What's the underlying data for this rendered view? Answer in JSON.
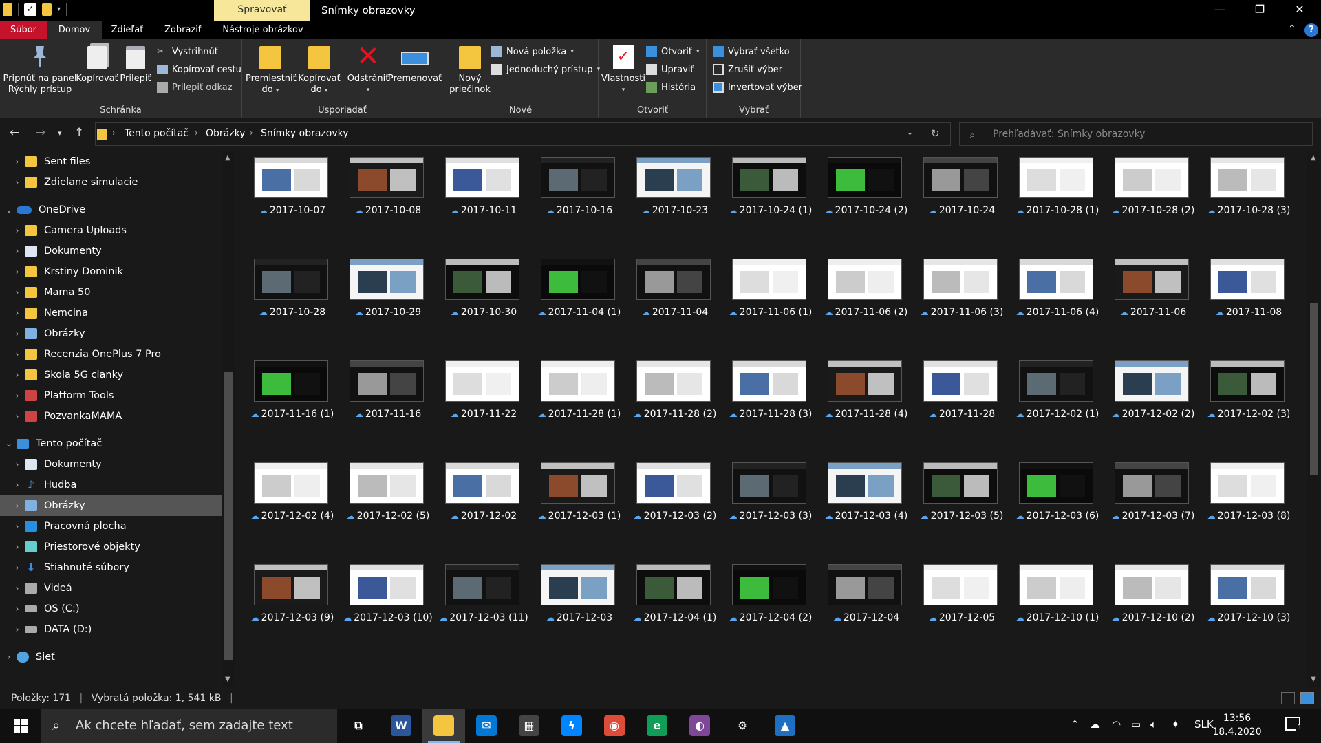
{
  "window": {
    "context_tab": "Spravovať",
    "title": "Snímky obrazovky",
    "minimize": "—",
    "restore": "❐",
    "close": "✕"
  },
  "ribbon_tabs": {
    "file": "Súbor",
    "home": "Domov",
    "share": "Zdieľať",
    "view": "Zobraziť",
    "picture_tools": "Nástroje obrázkov",
    "collapse": "⌃",
    "help": "?"
  },
  "ribbon": {
    "clipboard": {
      "label": "Schránka",
      "pin_line1": "Pripnúť na panel",
      "pin_line2": "Rýchly prístup",
      "copy": "Kopírovať",
      "paste": "Prilepiť",
      "cut": "Vystrihnúť",
      "copy_path": "Kopírovať cestu",
      "paste_shortcut": "Prilepiť odkaz"
    },
    "organize": {
      "label": "Usporiadať",
      "move_line1": "Premiestniť",
      "move_line2": "do",
      "copy_line1": "Kopírovať",
      "copy_line2": "do",
      "delete": "Odstrániť",
      "rename": "Premenovať"
    },
    "new": {
      "label": "Nové",
      "folder_line1": "Nový",
      "folder_line2": "priečinok",
      "new_item": "Nová položka",
      "easy_access": "Jednoduchý prístup"
    },
    "open": {
      "label": "Otvoriť",
      "properties": "Vlastnosti",
      "open": "Otvoriť",
      "edit": "Upraviť",
      "history": "História"
    },
    "select": {
      "label": "Vybrať",
      "select_all": "Vybrať všetko",
      "select_none": "Zrušiť výber",
      "invert": "Invertovať výber"
    }
  },
  "address": {
    "crumbs": [
      "Tento počítač",
      "Obrázky",
      "Snímky obrazovky"
    ],
    "search_placeholder": "Prehľadávať: Snímky obrazovky"
  },
  "nav_tree": [
    {
      "label": "Sent files",
      "icon": "folder",
      "indent": 1,
      "chevron": "›"
    },
    {
      "label": "Zdielane simulacie",
      "icon": "folder",
      "indent": 1,
      "chevron": "›"
    },
    {
      "label": "OneDrive",
      "icon": "cloud",
      "indent": 0,
      "chevron": "⌄"
    },
    {
      "label": "Camera Uploads",
      "icon": "folder",
      "indent": 1,
      "chevron": "›"
    },
    {
      "label": "Dokumenty",
      "icon": "doc",
      "indent": 1,
      "chevron": "›"
    },
    {
      "label": "Krstiny Dominik",
      "icon": "folder",
      "indent": 1,
      "chevron": "›"
    },
    {
      "label": "Mama 50",
      "icon": "folder",
      "indent": 1,
      "chevron": "›"
    },
    {
      "label": "Nemcina",
      "icon": "folder",
      "indent": 1,
      "chevron": "›"
    },
    {
      "label": "Obrázky",
      "icon": "pic",
      "indent": 1,
      "chevron": "›"
    },
    {
      "label": "Recenzia OnePlus 7 Pro",
      "icon": "folder",
      "indent": 1,
      "chevron": "›"
    },
    {
      "label": "Skola 5G clanky",
      "icon": "folder",
      "indent": 1,
      "chevron": "›"
    },
    {
      "label": "Platform Tools",
      "icon": "zip",
      "indent": 1,
      "chevron": "›"
    },
    {
      "label": "PozvankaMAMA",
      "icon": "zip",
      "indent": 1,
      "chevron": "›"
    },
    {
      "label": "Tento počítač",
      "icon": "pc",
      "indent": 0,
      "chevron": "⌄"
    },
    {
      "label": "Dokumenty",
      "icon": "doc",
      "indent": 1,
      "chevron": "›"
    },
    {
      "label": "Hudba",
      "icon": "music",
      "indent": 1,
      "chevron": "›"
    },
    {
      "label": "Obrázky",
      "icon": "pic",
      "indent": 1,
      "chevron": "›",
      "selected": true
    },
    {
      "label": "Pracovná plocha",
      "icon": "desk",
      "indent": 1,
      "chevron": "›"
    },
    {
      "label": "Priestorové objekty",
      "icon": "3d",
      "indent": 1,
      "chevron": "›"
    },
    {
      "label": "Stiahnuté súbory",
      "icon": "down",
      "indent": 1,
      "chevron": "›"
    },
    {
      "label": "Videá",
      "icon": "video",
      "indent": 1,
      "chevron": "›"
    },
    {
      "label": "OS (C:)",
      "icon": "drive",
      "indent": 1,
      "chevron": "›"
    },
    {
      "label": "DATA (D:)",
      "icon": "drive",
      "indent": 1,
      "chevron": "›"
    },
    {
      "label": "Sieť",
      "icon": "net",
      "indent": 0,
      "chevron": "›"
    }
  ],
  "files": [
    [
      "2017-10-07",
      "2017-10-08",
      "2017-10-11",
      "2017-10-16",
      "2017-10-23",
      "2017-10-24 (1)",
      "2017-10-24 (2)",
      "2017-10-24",
      "2017-10-28 (1)",
      "2017-10-28 (2)",
      "2017-10-28 (3)"
    ],
    [
      "2017-10-28",
      "2017-10-29",
      "2017-10-30",
      "2017-11-04 (1)",
      "2017-11-04",
      "2017-11-06 (1)",
      "2017-11-06 (2)",
      "2017-11-06 (3)",
      "2017-11-06 (4)",
      "2017-11-06",
      "2017-11-08"
    ],
    [
      "2017-11-16 (1)",
      "2017-11-16",
      "2017-11-22",
      "2017-11-28 (1)",
      "2017-11-28 (2)",
      "2017-11-28 (3)",
      "2017-11-28 (4)",
      "2017-11-28",
      "2017-12-02 (1)",
      "2017-12-02 (2)",
      "2017-12-02 (3)"
    ],
    [
      "2017-12-02 (4)",
      "2017-12-02 (5)",
      "2017-12-02",
      "2017-12-03 (1)",
      "2017-12-03 (2)",
      "2017-12-03 (3)",
      "2017-12-03 (4)",
      "2017-12-03 (5)",
      "2017-12-03 (6)",
      "2017-12-03 (7)",
      "2017-12-03 (8)"
    ],
    [
      "2017-12-03 (9)",
      "2017-12-03 (10)",
      "2017-12-03 (11)",
      "2017-12-03",
      "2017-12-04 (1)",
      "2017-12-04 (2)",
      "2017-12-04",
      "2017-12-05",
      "2017-12-10 (1)",
      "2017-12-10 (2)",
      "2017-12-10 (3)"
    ]
  ],
  "thumb_palette": [
    [
      "#ffffff",
      "#4a6fa5",
      "#d9d9d9"
    ],
    [
      "#1a1a1a",
      "#8b4a2b",
      "#c0c0c0"
    ],
    [
      "#ffffff",
      "#3b5998",
      "#e0e0e0"
    ],
    [
      "#111111",
      "#5c6b73",
      "#222222"
    ],
    [
      "#f5f5f5",
      "#2b3e50",
      "#7aa0c4"
    ],
    [
      "#0d0d0d",
      "#3a5a3a",
      "#bbbbbb"
    ],
    [
      "#0a0a0a",
      "#3dbb3d",
      "#111111"
    ],
    [
      "#111111",
      "#999999",
      "#444444"
    ],
    [
      "#ffffff",
      "#dddddd",
      "#f0f0f0"
    ],
    [
      "#ffffff",
      "#cccccc",
      "#eeeeee"
    ],
    [
      "#ffffff",
      "#bbbbbb",
      "#e6e6e6"
    ]
  ],
  "status": {
    "count": "Položky: 171",
    "selected": "Vybratá položka: 1, 541 kB"
  },
  "taskbar": {
    "search_placeholder": "Ak chcete hľadať, sem zadajte text",
    "apps": [
      {
        "name": "task-view",
        "glyph": "⧉",
        "color": "transparent"
      },
      {
        "name": "word",
        "glyph": "W",
        "color": "#2b579a"
      },
      {
        "name": "file-explorer",
        "glyph": "",
        "color": "#f4c53f",
        "active": true
      },
      {
        "name": "mail",
        "glyph": "✉",
        "color": "#0078d4"
      },
      {
        "name": "store",
        "glyph": "▦",
        "color": "#444444"
      },
      {
        "name": "messenger",
        "glyph": "ϟ",
        "color": "#0084ff"
      },
      {
        "name": "chrome",
        "glyph": "◉",
        "color": "#dd4b39"
      },
      {
        "name": "edge-beta",
        "glyph": "e",
        "color": "#0f9d58"
      },
      {
        "name": "tor",
        "glyph": "◐",
        "color": "#7e4798"
      },
      {
        "name": "settings",
        "glyph": "⚙",
        "color": "transparent"
      },
      {
        "name": "photos",
        "glyph": "▲",
        "color": "#1e6fc2"
      }
    ],
    "lang": "SLK",
    "time": "13:56",
    "date": "18.4.2020",
    "notifications": "1"
  }
}
